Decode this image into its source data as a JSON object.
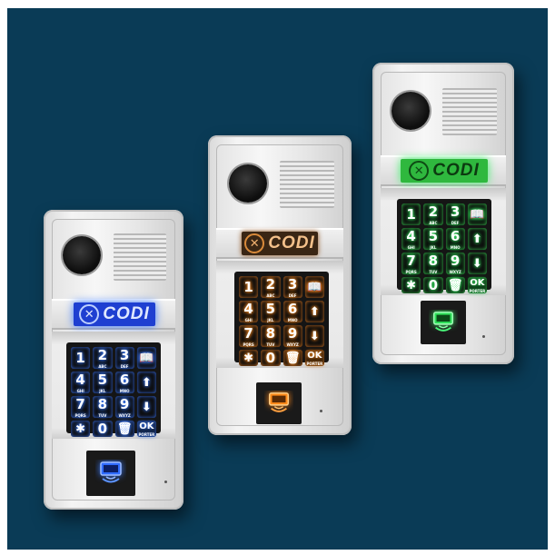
{
  "scene": {
    "background_color": "#0a3b56",
    "panel_count": 3
  },
  "panels": [
    {
      "name": "blue-intercom",
      "glow_color": "#3b7bff",
      "logo_text": "CODI",
      "keys": [
        {
          "d": "1",
          "s": ""
        },
        {
          "d": "2",
          "s": "ABC"
        },
        {
          "d": "3",
          "s": "DEF"
        },
        {
          "icon": "book-icon"
        },
        {
          "d": "4",
          "s": "GHI"
        },
        {
          "d": "5",
          "s": "JKL"
        },
        {
          "d": "6",
          "s": "MNO"
        },
        {
          "icon": "arrow-up-icon"
        },
        {
          "d": "7",
          "s": "PQRS"
        },
        {
          "d": "8",
          "s": "TUV"
        },
        {
          "d": "9",
          "s": "WXYZ"
        },
        {
          "icon": "arrow-down-icon"
        },
        {
          "icon": "asterisk-icon"
        },
        {
          "d": "0",
          "s": ""
        },
        {
          "icon": "trash-icon"
        },
        {
          "d": "OK",
          "s": "PORTER"
        }
      ],
      "reader_icon": "card-reader-icon"
    },
    {
      "name": "orange-intercom",
      "glow_color": "#ff8a1a",
      "logo_text": "CODI",
      "keys": [
        {
          "d": "1",
          "s": ""
        },
        {
          "d": "2",
          "s": "ABC"
        },
        {
          "d": "3",
          "s": "DEF"
        },
        {
          "icon": "book-icon"
        },
        {
          "d": "4",
          "s": "GHI"
        },
        {
          "d": "5",
          "s": "JKL"
        },
        {
          "d": "6",
          "s": "MNO"
        },
        {
          "icon": "arrow-up-icon"
        },
        {
          "d": "7",
          "s": "PQRS"
        },
        {
          "d": "8",
          "s": "TUV"
        },
        {
          "d": "9",
          "s": "WXYZ"
        },
        {
          "icon": "arrow-down-icon"
        },
        {
          "icon": "asterisk-icon"
        },
        {
          "d": "0",
          "s": ""
        },
        {
          "icon": "trash-icon"
        },
        {
          "d": "OK",
          "s": "PORTER"
        }
      ],
      "reader_icon": "card-reader-icon"
    },
    {
      "name": "green-intercom",
      "glow_color": "#3ef06a",
      "logo_text": "CODI",
      "keys": [
        {
          "d": "1",
          "s": ""
        },
        {
          "d": "2",
          "s": "ABC"
        },
        {
          "d": "3",
          "s": "DEF"
        },
        {
          "icon": "book-icon"
        },
        {
          "d": "4",
          "s": "GHI"
        },
        {
          "d": "5",
          "s": "JKL"
        },
        {
          "d": "6",
          "s": "MNO"
        },
        {
          "icon": "arrow-up-icon"
        },
        {
          "d": "7",
          "s": "PQRS"
        },
        {
          "d": "8",
          "s": "TUV"
        },
        {
          "d": "9",
          "s": "WXYZ"
        },
        {
          "icon": "arrow-down-icon"
        },
        {
          "icon": "asterisk-icon"
        },
        {
          "d": "0",
          "s": ""
        },
        {
          "icon": "trash-icon"
        },
        {
          "d": "OK",
          "s": "PORTER"
        }
      ],
      "reader_icon": "card-reader-icon"
    }
  ]
}
